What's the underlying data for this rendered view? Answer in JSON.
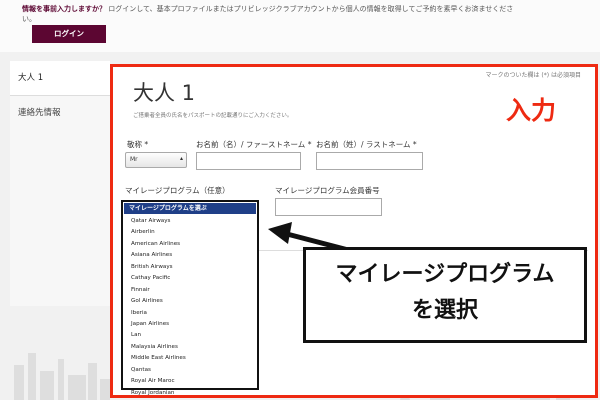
{
  "banner": {
    "info_bold": "情報を事前入力しますか？",
    "info_rest": "ログインして、基本プロファイルまたはプリビレッジクラブアカウントから個人の情報を取得してご予約を素早くお済ませください。",
    "login_label": "ログイン"
  },
  "sidebar": {
    "items": [
      {
        "label": "大人 1"
      },
      {
        "label": "連絡先情報"
      }
    ]
  },
  "form": {
    "required_note": "マークのついた欄は (*) は必須項目",
    "heading": "大人 1",
    "subtitle": "ご搭乗者全員の氏名をパスポートの記載通りにご入力ください。",
    "title_label": "敬称 *",
    "title_value": "Mr",
    "first_name_label": "お名前（名）/ ファーストネーム *",
    "last_name_label": "お名前（姓）/ ラストネーム *",
    "mileage_label": "マイレージプログラム（任意）",
    "member_no_label": "マイレージプログラム会員番号"
  },
  "dropdown": {
    "header": "マイレージプログラムを選ぶ",
    "options": [
      "Qatar Airways",
      "Airberlin",
      "American Airlines",
      "Asiana Airlines",
      "British Airways",
      "Cathay Pacific",
      "Finnair",
      "Gol Airlines",
      "Iberia",
      "Japan Airlines",
      "Lan",
      "Malaysia Airlines",
      "Middle East Airlines",
      "Qantas",
      "Royal Air Maroc",
      "Royal Jordanian"
    ]
  },
  "annotation": {
    "input_label": "入力",
    "callout_line1": "マイレージプログラム",
    "callout_line2": "を選択"
  },
  "colors": {
    "brand": "#5c0632",
    "annotation_red": "#ee2a12",
    "dropdown_header": "#1f3f88"
  }
}
